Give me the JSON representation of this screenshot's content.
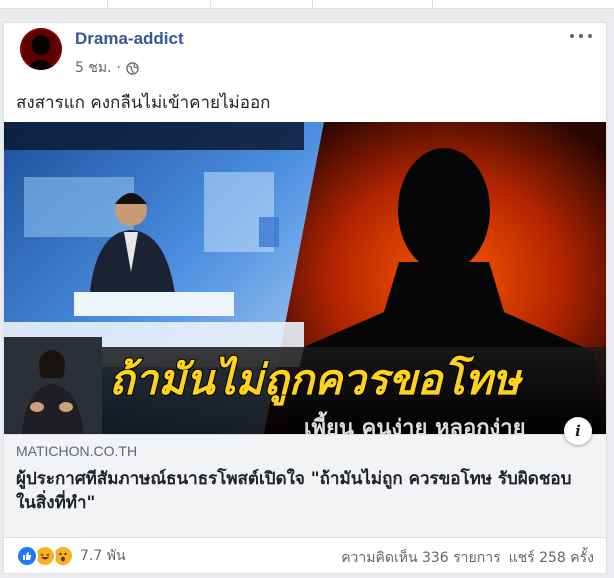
{
  "post": {
    "author": "Drama-addict",
    "time": "5 ชม.",
    "separator": "·",
    "privacy_icon": "globe-icon",
    "text": "สงสารแก คงกลืนไม่เข้าคายไม่ออก"
  },
  "media": {
    "overlay_text": "ถ้ามันไม่ถูกควรขอโทษ",
    "overlay_subtext": "เพี้ยน คนง่าย หลอกง่าย"
  },
  "link": {
    "domain": "MATICHON.CO.TH",
    "title": "ผู้ประกาศทีสัมภาษณ์ธนาธรโพสต์เปิดใจ \"ถ้ามันไม่ถูก ควรขอโทษ รับผิดชอบในสิ่งที่ทำ\"",
    "info_label": "i"
  },
  "footer": {
    "reaction_icons": [
      "like-icon",
      "haha-icon",
      "wow-icon"
    ],
    "reaction_count": "7.7 พัน",
    "comments": "ความคิดเห็น 336 รายการ",
    "shares": "แชร์ 258 ครั้ง"
  },
  "colors": {
    "author_link": "#365899",
    "like_blue": "#2078f4",
    "reaction_yellow": "#f7b125",
    "overlay_yellow": "#ffd319",
    "overlay_orange": "#ff7a00"
  }
}
